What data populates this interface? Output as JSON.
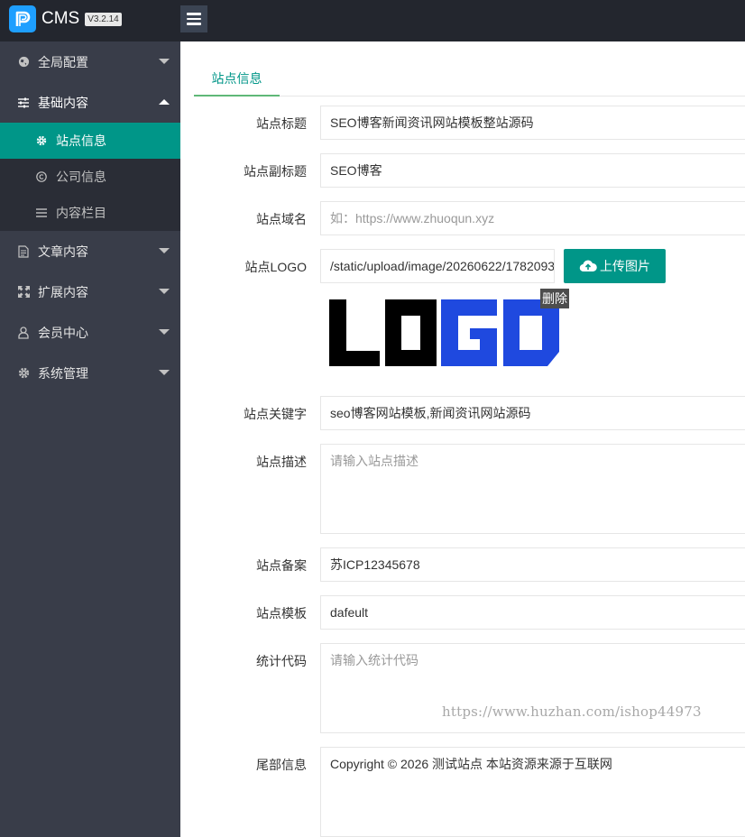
{
  "header": {
    "app_title": "CMS",
    "version": "V3.2.14"
  },
  "sidebar": {
    "items": [
      {
        "label": "全局配置",
        "icon": "globe-icon",
        "expanded": false
      },
      {
        "label": "基础内容",
        "icon": "sliders-icon",
        "expanded": true,
        "children": [
          {
            "label": "站点信息",
            "icon": "gear-icon",
            "active": true
          },
          {
            "label": "公司信息",
            "icon": "copyright-icon",
            "active": false
          },
          {
            "label": "内容栏目",
            "icon": "list-icon",
            "active": false
          }
        ]
      },
      {
        "label": "文章内容",
        "icon": "document-icon",
        "expanded": false
      },
      {
        "label": "扩展内容",
        "icon": "expand-icon",
        "expanded": false
      },
      {
        "label": "会员中心",
        "icon": "user-icon",
        "expanded": false
      },
      {
        "label": "系统管理",
        "icon": "gear-icon",
        "expanded": false
      }
    ]
  },
  "main": {
    "tab_label": "站点信息",
    "form": {
      "title": {
        "label": "站点标题",
        "value": "SEO博客新闻资讯网站模板整站源码"
      },
      "subtitle": {
        "label": "站点副标题",
        "value": "SEO博客"
      },
      "domain": {
        "label": "站点域名",
        "value": "",
        "placeholder": "如：https://www.zhuoqun.xyz"
      },
      "logo": {
        "label": "站点LOGO",
        "value": "/static/upload/image/20260622/1782093",
        "upload_label": "上传图片",
        "delete_label": "删除",
        "image_text": "LOGO"
      },
      "keywords": {
        "label": "站点关键字",
        "value": "seo博客网站模板,新闻资讯网站源码"
      },
      "description": {
        "label": "站点描述",
        "value": "",
        "placeholder": "请输入站点描述"
      },
      "icp": {
        "label": "站点备案",
        "value": "苏ICP12345678"
      },
      "template": {
        "label": "站点模板",
        "value": "dafeult"
      },
      "stats": {
        "label": "统计代码",
        "value": "",
        "placeholder": "请输入统计代码"
      },
      "footer": {
        "label": "尾部信息",
        "value": "Copyright © 2026 测试站点 本站资源来源于互联网"
      }
    },
    "watermark": "https://www.huzhan.com/ishop44973"
  },
  "colors": {
    "topbar": "#23262e",
    "sidebar": "#393d49",
    "submenu": "#2a2d36",
    "accent": "#009688",
    "tab_underline": "#5fb878"
  }
}
